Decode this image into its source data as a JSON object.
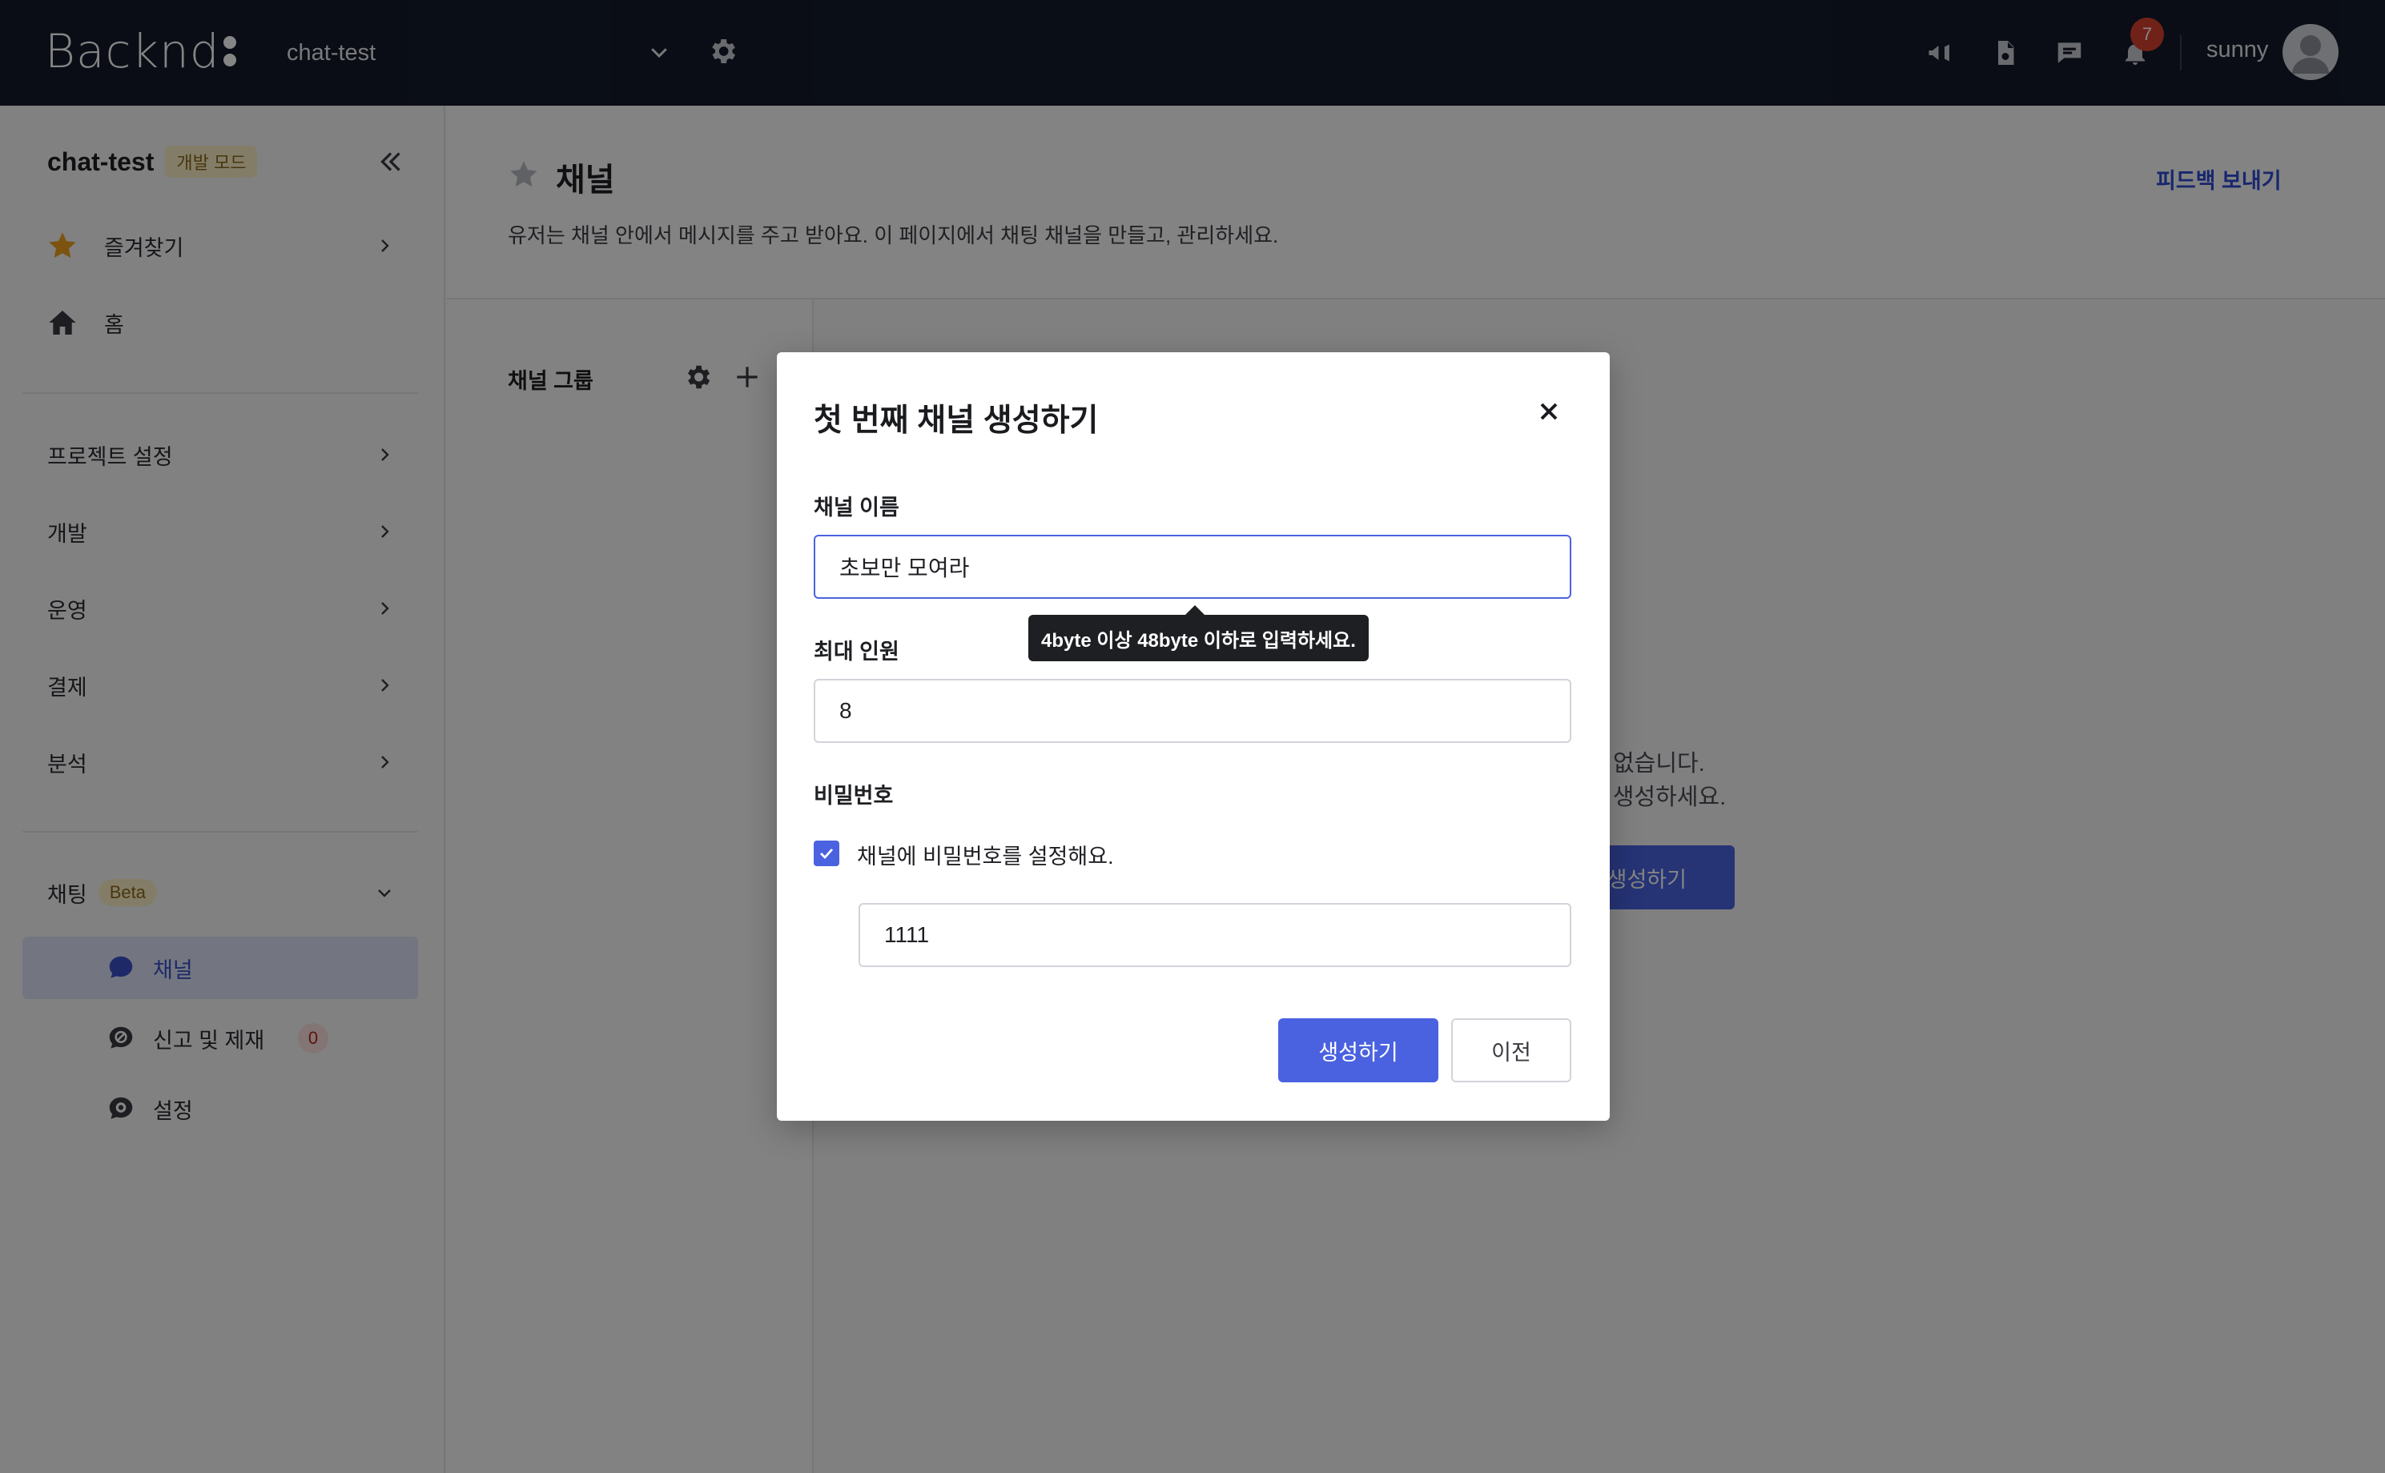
{
  "topbar": {
    "logo": "Backnd",
    "project_name": "chat-test",
    "notification_count": "7",
    "username": "sunny",
    "icons": [
      "megaphone-icon",
      "document-icon",
      "chat-icon",
      "bell-icon"
    ]
  },
  "sidebar": {
    "project_name": "chat-test",
    "mode_badge": "개발 모드",
    "items": [
      {
        "label": "즐겨찾기",
        "icon": "star-icon"
      },
      {
        "label": "홈",
        "icon": "home-icon"
      },
      {
        "label": "프로젝트 설정"
      },
      {
        "label": "개발"
      },
      {
        "label": "운영"
      },
      {
        "label": "결제"
      },
      {
        "label": "분석"
      }
    ],
    "chat_section": {
      "label": "채팅",
      "badge": "Beta",
      "sub_items": [
        {
          "label": "채널",
          "icon": "chat-bubble-icon",
          "active": true
        },
        {
          "label": "신고 및 제재",
          "icon": "report-icon",
          "count": "0"
        },
        {
          "label": "설정",
          "icon": "chat-settings-icon"
        }
      ]
    }
  },
  "page": {
    "title": "채널",
    "description": "유저는 채널 안에서 메시지를 주고 받아요. 이 페이지에서 채팅 채널을 만들고, 관리하세요.",
    "feedback_link": "피드백 보내기",
    "group_panel_title": "채널 그룹",
    "empty_line1": "없습니다.",
    "empty_line2": "· 생성하세요.",
    "empty_button": "생성하기"
  },
  "modal": {
    "title": "첫 번째 채널 생성하기",
    "channel_name_label": "채널 이름",
    "channel_name_value": "초보만 모여라",
    "tooltip": "4byte 이상 48byte 이하로 입력하세요.",
    "max_members_label": "최대 인원",
    "max_members_value": "8",
    "password_label": "비밀번호",
    "password_checkbox_label": "채널에 비밀번호를 설정해요.",
    "password_checked": true,
    "password_value": "1111",
    "create_button": "생성하기",
    "back_button": "이전"
  },
  "colors": {
    "topbar_bg": "#141a2b",
    "accent": "#4a62e0",
    "badge_red": "#d9412f",
    "star": "#f0a020"
  }
}
